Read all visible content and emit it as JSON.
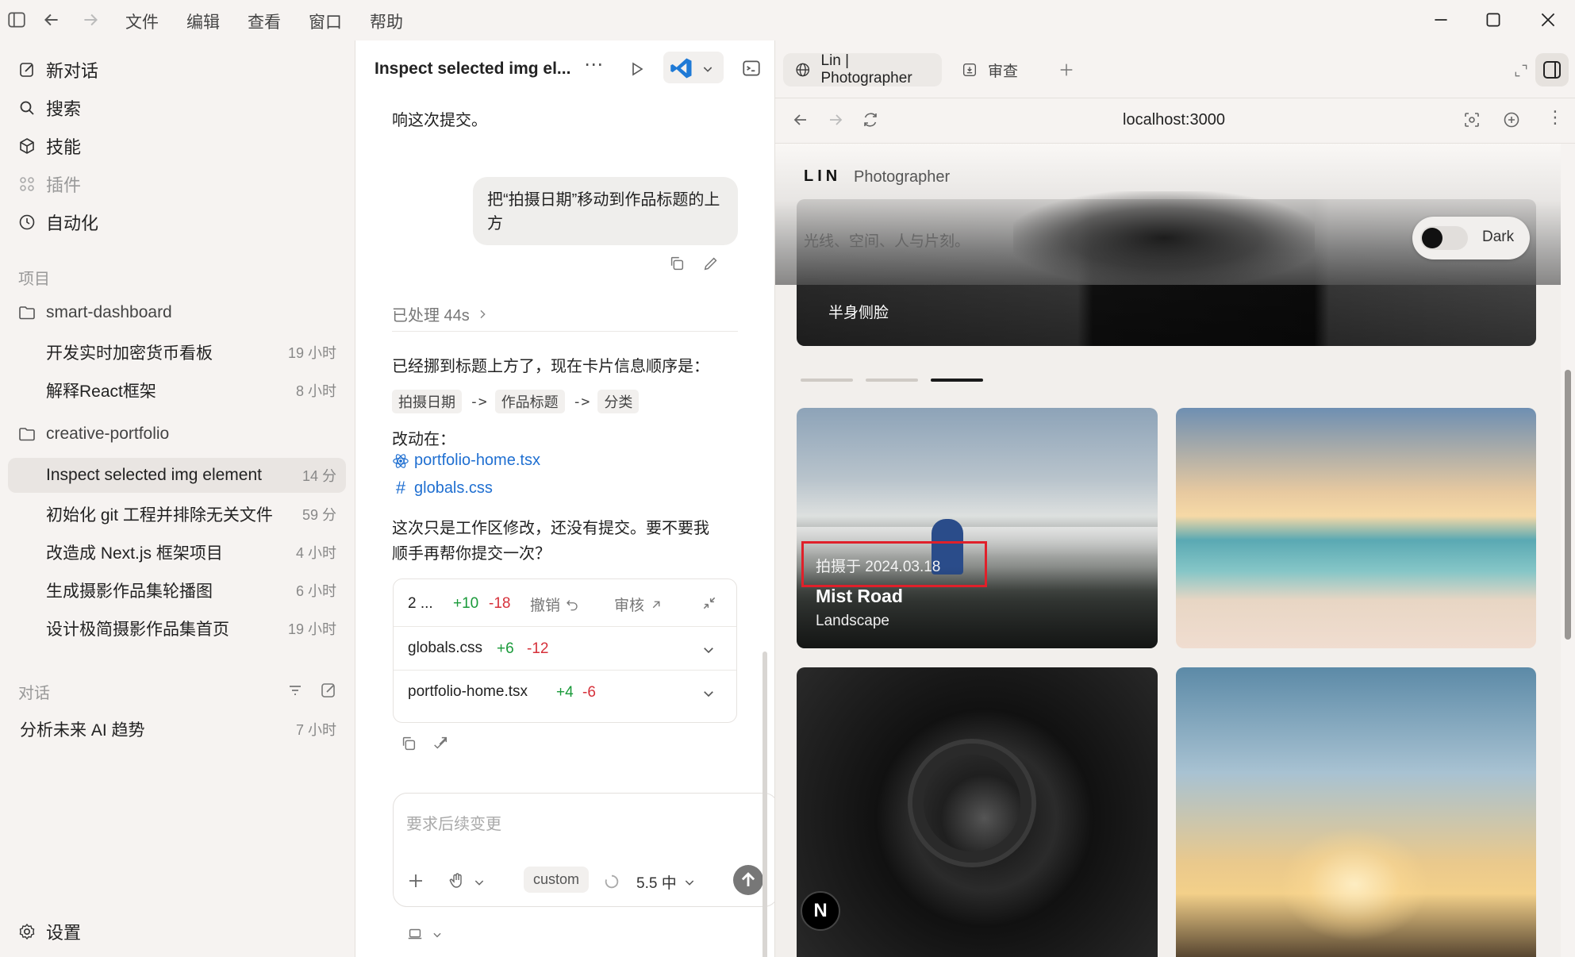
{
  "menu": [
    "文件",
    "编辑",
    "查看",
    "窗口",
    "帮助"
  ],
  "sidebar": {
    "nav": [
      {
        "label": "新对话",
        "icon": "edit-icon"
      },
      {
        "label": "搜索",
        "icon": "search-icon"
      },
      {
        "label": "技能",
        "icon": "cube-icon"
      },
      {
        "label": "插件",
        "icon": "grid-icon"
      },
      {
        "label": "自动化",
        "icon": "clock-icon"
      }
    ],
    "projects_label": "项目",
    "projects": [
      {
        "name": "smart-dashboard",
        "threads": [
          {
            "title": "开发实时加密货币看板",
            "time": "19 小时"
          },
          {
            "title": "解释React框架",
            "time": "8 小时"
          }
        ]
      },
      {
        "name": "creative-portfolio",
        "threads": [
          {
            "title": "Inspect selected img element",
            "time": "14 分"
          },
          {
            "title": "初始化 git 工程并排除无关文件",
            "time": "59 分"
          },
          {
            "title": "改造成 Next.js 框架项目",
            "time": "4 小时"
          },
          {
            "title": "生成摄影作品集轮播图",
            "time": "6 小时"
          },
          {
            "title": "设计极简摄影作品集首页",
            "time": "19 小时"
          }
        ]
      }
    ],
    "conversations_label": "对话",
    "conversations": [
      {
        "title": "分析未来 AI 趋势",
        "time": "7 小时"
      }
    ],
    "settings_label": "设置"
  },
  "chat": {
    "title": "Inspect selected img el...",
    "prev_text": "响这次提交。",
    "user_message": "把“拍摄日期”移动到作品标题的上方",
    "processed": "已处理 44s",
    "reply_line1": "已经挪到标题上方了，现在卡片信息顺序是：",
    "order": [
      "拍摄日期",
      "->",
      "作品标题",
      "->",
      "分类"
    ],
    "changed_label": "改动在：",
    "files": [
      {
        "name": "portfolio-home.tsx",
        "icon": "react-icon"
      },
      {
        "name": "globals.css",
        "icon": "hash-icon"
      }
    ],
    "reply_line2": "这次只是工作区修改，还没有提交。要不要我",
    "reply_line3": "顺手再帮你提交一次？",
    "diff_summary": {
      "count": "2 ...",
      "add": "+10",
      "del": "-18",
      "undo": "撤销",
      "review": "审核"
    },
    "diff_files": [
      {
        "name": "globals.css",
        "add": "+6",
        "del": "-12"
      },
      {
        "name": "portfolio-home.tsx",
        "add": "+4",
        "del": "-6"
      }
    ],
    "input_placeholder": "要求后续变更",
    "mode": "custom",
    "model": "5.5 中"
  },
  "browser": {
    "tabs": [
      {
        "label": "Lin | Photographer"
      },
      {
        "label": "审查"
      }
    ],
    "url": "localhost:3000",
    "site_logo": "LIN",
    "site_role": "Photographer",
    "tagline": "光线、空间、人与片刻。",
    "toggle_label": "Dark",
    "hero_subtitle": "半身侧脸",
    "card1": {
      "date": "拍摄于 2024.03.18",
      "title": "Mist Road",
      "category": "Landscape"
    },
    "next_badge": "N"
  },
  "colors": {
    "accent_red": "#e0202a",
    "link_blue": "#1f6fd1",
    "add_green": "#1a9a3a",
    "del_red": "#d6303a"
  }
}
